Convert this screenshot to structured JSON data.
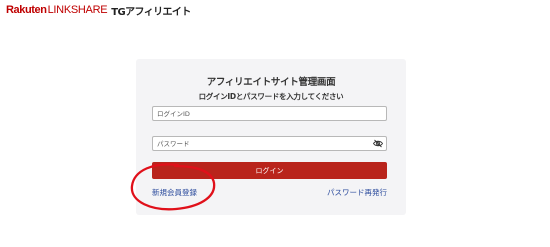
{
  "header": {
    "brand_rakuten": "Rakuten",
    "brand_linkshare": "LINKSHARE",
    "brand_tg": "TGアフィリエイト"
  },
  "login_card": {
    "title": "アフィリエイトサイト管理画面",
    "subtitle": "ログインIDとパスワードを入力してください",
    "login_id": {
      "value": "",
      "placeholder": "ログインID"
    },
    "password": {
      "value": "",
      "placeholder": "パスワード",
      "toggle_icon": "eye-slash-icon"
    },
    "login_button": "ログイン",
    "register_link": "新規会員登録",
    "reset_link": "パスワード再発行"
  },
  "colors": {
    "brand_red": "#bf0000",
    "button_red": "#b9241c",
    "link_blue": "#2a4a9c",
    "card_bg": "#f4f4f6",
    "annotation_red": "#e0101a"
  }
}
